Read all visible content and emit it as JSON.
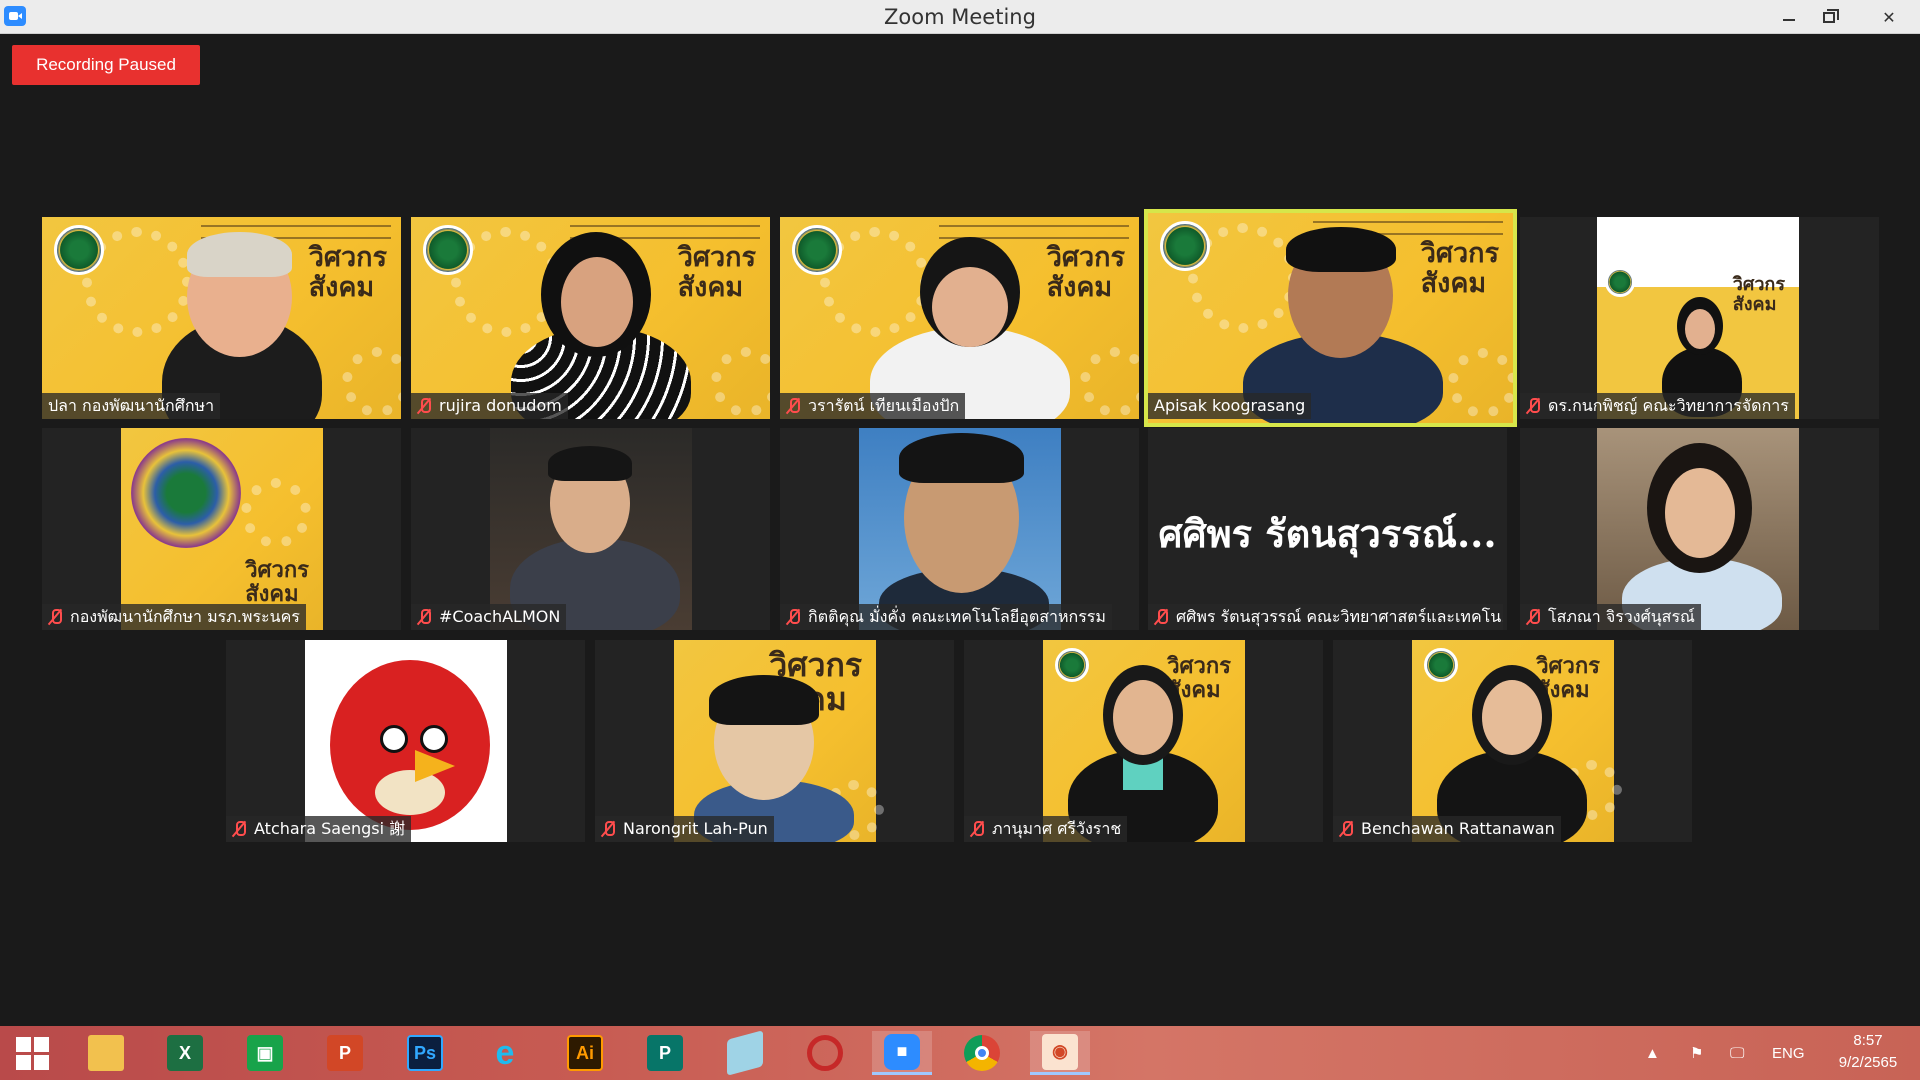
{
  "window": {
    "title": "Zoom Meeting"
  },
  "recording": {
    "label": "Recording Paused"
  },
  "participants": [
    {
      "name": "ปลา กองพัฒนานักศึกษา",
      "muted": false
    },
    {
      "name": "rujira donudom",
      "muted": true
    },
    {
      "name": "วรารัตน์ เทียนเมืองปัก",
      "muted": true
    },
    {
      "name": "Apisak koograsang",
      "muted": false,
      "active": true
    },
    {
      "name": "ดร.กนกพิชญ์ คณะวิทยาการจัดการ",
      "muted": true
    },
    {
      "name": "กองพัฒนานักศึกษา มรภ.พระนคร",
      "muted": true
    },
    {
      "name": "#CoachALMON",
      "muted": true
    },
    {
      "name": "กิตติคุณ มั่งคั่ง คณะเทคโนโลยีอุตสาหกรรม",
      "muted": true
    },
    {
      "name": "ศศิพร รัตนสุวรรณ์ คณะวิทยาศาสตร์และเทคโน...",
      "muted": true,
      "display_text": "ศศิพร รัตนสุวรรณ์..."
    },
    {
      "name": "โสภณา จิรวงศ์นุสรณ์",
      "muted": true
    },
    {
      "name": "Atchara Saengsi 謝",
      "muted": true
    },
    {
      "name": "Narongrit Lah-Pun",
      "muted": true
    },
    {
      "name": "ภานุมาศ ศรีวังราช",
      "muted": true
    },
    {
      "name": "Benchawan Rattanawan",
      "muted": true
    }
  ],
  "branding": {
    "text_line1": "วิศวกร",
    "text_line2": "สังคม"
  },
  "taskbar": {
    "icons": [
      "windows-start",
      "file-explorer",
      "excel",
      "store",
      "powerpoint",
      "photoshop",
      "internet-explorer",
      "illustrator",
      "publisher",
      "notepad",
      "photoscape",
      "zoom",
      "chrome",
      "paint"
    ],
    "illustrator_label": "Ai",
    "photoshop_label": "Ps",
    "excel_label": "X",
    "powerpoint_label": "P",
    "publisher_label": "P"
  },
  "tray": {
    "language": "ENG"
  },
  "clock": {
    "time": "8:57",
    "date": "9/2/2565"
  },
  "colors": {
    "recording": "#e8312f",
    "active_speaker": "#d6e64a",
    "tile_bg": "#232323",
    "brand_yellow": "#f2c640"
  }
}
